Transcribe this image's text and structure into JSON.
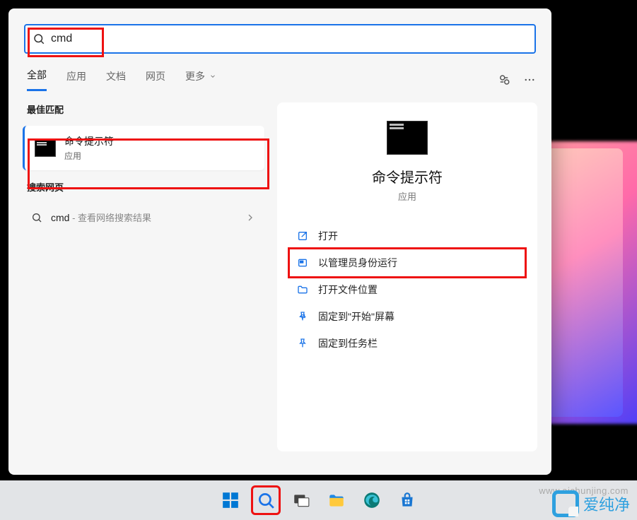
{
  "search": {
    "value": "cmd"
  },
  "tabs": {
    "all": "全部",
    "apps": "应用",
    "docs": "文档",
    "web": "网页",
    "more": "更多"
  },
  "left": {
    "best_header": "最佳匹配",
    "best_title": "命令提示符",
    "best_sub": "应用",
    "web_header": "搜索网页",
    "web_term": "cmd",
    "web_sub": " - 查看网络搜索结果"
  },
  "detail": {
    "title": "命令提示符",
    "sub": "应用",
    "actions": {
      "open": "打开",
      "admin": "以管理员身份运行",
      "loc": "打开文件位置",
      "pin_start": "固定到\"开始\"屏幕",
      "pin_tb": "固定到任务栏"
    }
  },
  "watermark": {
    "brand": "爱纯净",
    "url": "www.aichunjing.com"
  }
}
